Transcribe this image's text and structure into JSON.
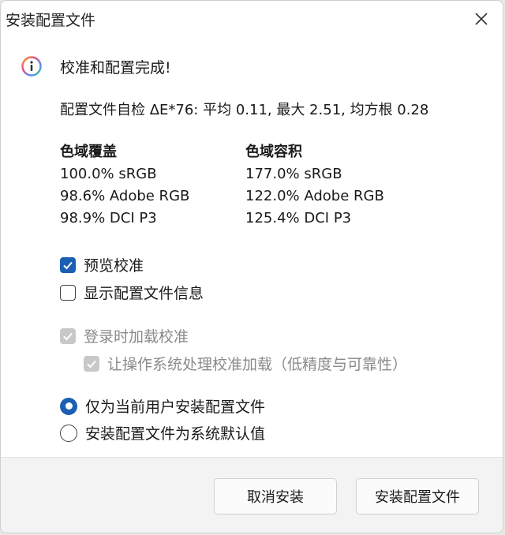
{
  "window": {
    "title": "安装配置文件"
  },
  "main": {
    "heading": "校准和配置完成!",
    "delta_line": "配置文件自检 ΔE*76: 平均 0.11, 最大 2.51, 均方根 0.28"
  },
  "gamut_coverage": {
    "title": "色域覆盖",
    "rows": [
      "100.0% sRGB",
      "98.6% Adobe RGB",
      "98.9% DCI P3"
    ]
  },
  "gamut_volume": {
    "title": "色域容积",
    "rows": [
      "177.0% sRGB",
      "122.0% Adobe RGB",
      "125.4% DCI P3"
    ]
  },
  "options": {
    "preview_calibration": {
      "label": "预览校准",
      "checked": true
    },
    "show_profile_info": {
      "label": "显示配置文件信息",
      "checked": false
    },
    "load_on_login": {
      "label": "登录时加载校准",
      "checked": true,
      "disabled": true
    },
    "os_handles_loading": {
      "label": "让操作系统处理校准加载（低精度与可靠性）",
      "checked": true,
      "disabled": true
    }
  },
  "install_scope": {
    "current_user": {
      "label": "仅为当前用户安装配置文件",
      "selected": true
    },
    "system_default": {
      "label": "安装配置文件为系统默认值",
      "selected": false
    }
  },
  "footer": {
    "cancel_label": "取消安装",
    "install_label": "安装配置文件"
  },
  "colors": {
    "accent": "#1a5fb4",
    "disabled_gray": "#c8c8c8",
    "footer_bg": "#f3f3f3"
  },
  "icons": {
    "close": "close-icon",
    "info": "info-icon",
    "check": "checkmark-icon"
  }
}
